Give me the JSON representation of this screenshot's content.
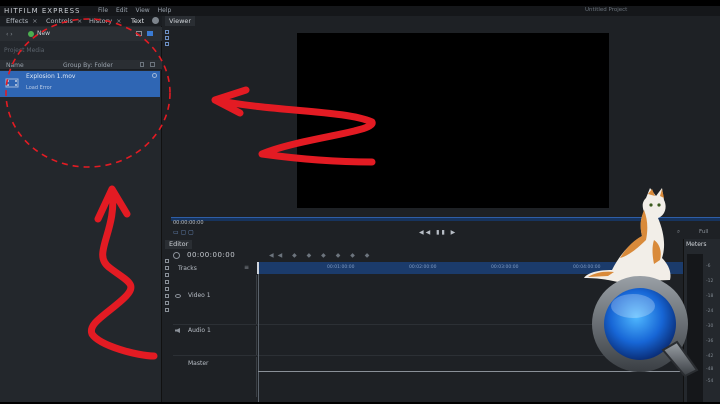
{
  "app": {
    "logo": "HITFILM EXPRESS",
    "menu": "File  Edit  View  Help",
    "project_title": "Untitled Project"
  },
  "left_panel": {
    "tabs": [
      {
        "label": "Effects"
      },
      {
        "label": "Controls"
      },
      {
        "label": "History"
      },
      {
        "label": "Text"
      }
    ],
    "new_label": "New",
    "crumb": "Project Media",
    "view_label": "Name",
    "group_label": "Group By: Folder",
    "file": {
      "name": "Explosion 1.mov",
      "status": "Load Error"
    }
  },
  "viewer": {
    "tab": "Viewer",
    "timecode": "00:00:00:00",
    "play_controls": "◀◀ ▮▮ ▶",
    "quality": "Full",
    "zoom_icon": "magnifier-icon"
  },
  "editor": {
    "tab": "Editor",
    "timecode": "00:00:00:00",
    "tracks_label": "Tracks",
    "ruler_ticks": [
      "00:01:00:00",
      "00:02:00:00",
      "00:03:00:00",
      "00:04:00:00"
    ],
    "tracks": [
      {
        "name": "Video 1"
      },
      {
        "name": "Audio 1"
      },
      {
        "name": "Master"
      }
    ]
  },
  "meters": {
    "title": "Meters",
    "labels": [
      "-6",
      "-12",
      "-18",
      "-24",
      "-30",
      "-36",
      "-42",
      "-48",
      "-54"
    ]
  },
  "colors": {
    "accent_blue": "#2f66b4",
    "annotation_red": "#e31b23"
  }
}
